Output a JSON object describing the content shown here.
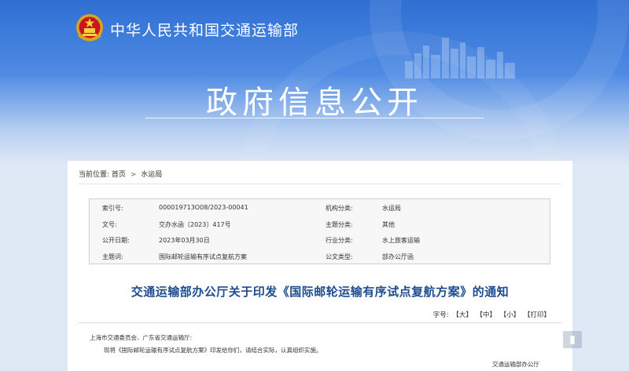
{
  "header": {
    "site_name": "中华人民共和国交通运输部",
    "banner_title": "政府信息公开"
  },
  "breadcrumb": {
    "label": "当前位置:",
    "home": "首页",
    "separator": ">",
    "section": "水运局"
  },
  "meta": {
    "rows": [
      {
        "label1": "索引号:",
        "value1": "000019713O08/2023-00041",
        "label2": "机构分类:",
        "value2": "水运局"
      },
      {
        "label1": "文号:",
        "value1": "交办水函〔2023〕417号",
        "label2": "主题分类:",
        "value2": "其他"
      },
      {
        "label1": "公开日期:",
        "value1": "2023年03月30日",
        "label2": "行业分类:",
        "value2": "水上旅客运输"
      },
      {
        "label1": "主题词:",
        "value1": "国际邮轮运输有序试点复航方案",
        "label2": "公文类型:",
        "value2": "部办公厅函"
      }
    ]
  },
  "document": {
    "title": "交通运输部办公厅关于印发《国际邮轮运输有序试点复航方案》的通知",
    "font_size_label": "字号:",
    "font_size_options": [
      "【大】",
      "【中】",
      "【小】",
      "【打印】"
    ],
    "recipients": "上海市交通委员会、广东省交通运输厅:",
    "body_line": "现将《国际邮轮运输有序试点复航方案》印发给你们，请结合实际，认真组织实施。",
    "signature": "交通运输部办公厅"
  },
  "colors": {
    "banner_blue": "#2f6fd2",
    "title_blue": "#1c4c8f"
  }
}
